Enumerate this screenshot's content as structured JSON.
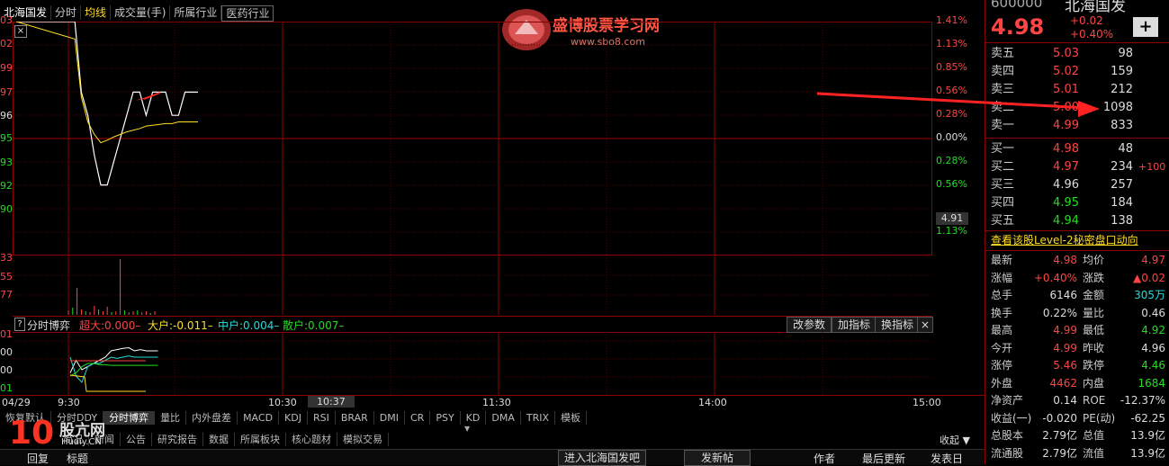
{
  "tabs": [
    "北海国发",
    "分时",
    "均线",
    "成交量(手)",
    "所属行业",
    "医药行业"
  ],
  "watermark": {
    "brand": "盛博股票学习网",
    "url": "www.sbo8.com"
  },
  "price_axis_left": [
    "03",
    "02",
    "99",
    "97",
    "96",
    "95",
    "93",
    "92",
    "90"
  ],
  "pct_axis_right": {
    "up": [
      "1.41%",
      "1.13%",
      "0.85%",
      "0.56%",
      "0.28%"
    ],
    "zero": "0.00%",
    "down": [
      "0.28%",
      "0.56%",
      "0.85%",
      "1.13%"
    ]
  },
  "cursor_price": "4.91",
  "volume_axis_left": [
    "33",
    "55",
    "77"
  ],
  "indicator_bar": {
    "q": "?",
    "name": "分时博弈",
    "super": "超大:0.000–",
    "big": "大户:-0.011–",
    "mid": "中户:0.004–",
    "small": "散户:0.007–",
    "buttons": [
      "改参数",
      "加指标",
      "换指标"
    ],
    "close": "×"
  },
  "indicator_axis_left": [
    "01",
    "00",
    "00",
    "01"
  ],
  "time_axis": {
    "date": "04/29",
    "labels": [
      "9:30",
      "10:30",
      "10:37",
      "11:30",
      "14:00",
      "15:00"
    ]
  },
  "bottom_tabs": [
    "恢复默认",
    "分时DDY",
    "分时博弈",
    "量比",
    "内外盘差",
    "MACD",
    "KDJ",
    "RSI",
    "BRAR",
    "DMI",
    "CR",
    "PSY",
    "KD",
    "DMA",
    "TRIX",
    "模板"
  ],
  "bottom_tabs2": [
    "简况",
    "新闻",
    "公告",
    "研究报告",
    "数据",
    "所属板块",
    "核心题材",
    "模拟交易"
  ],
  "collapse": "收起",
  "footer": {
    "left": [
      "回复",
      "标题"
    ],
    "buttons": [
      "进入北海国发吧",
      "发新帖"
    ],
    "cols": [
      "作者",
      "最后更新",
      "发表日"
    ]
  },
  "logo": {
    "num": "10",
    "text": "股亢网",
    "sub": "Huaiy.CN"
  },
  "quote": {
    "code": "600000",
    "name": "北海国发",
    "price": "4.98",
    "chg": "+0.02",
    "pct": "+0.40%",
    "plus": "+"
  },
  "asks": [
    {
      "label": "卖五",
      "price": "5.03",
      "vol": "98"
    },
    {
      "label": "卖四",
      "price": "5.02",
      "vol": "159"
    },
    {
      "label": "卖三",
      "price": "5.01",
      "vol": "212"
    },
    {
      "label": "卖二",
      "price": "5.00",
      "vol": "1098"
    },
    {
      "label": "卖一",
      "price": "4.99",
      "vol": "833"
    }
  ],
  "bids": [
    {
      "label": "买一",
      "price": "4.98",
      "vol": "48",
      "extra": ""
    },
    {
      "label": "买二",
      "price": "4.97",
      "vol": "234",
      "extra": "+100"
    },
    {
      "label": "买三",
      "price": "4.96",
      "vol": "257",
      "extra": ""
    },
    {
      "label": "买四",
      "price": "4.95",
      "vol": "184",
      "extra": ""
    },
    {
      "label": "买五",
      "price": "4.94",
      "vol": "138",
      "extra": ""
    }
  ],
  "level2": "查看该股Level-2秘密盘口动向",
  "stats": [
    [
      "最新",
      "4.98",
      "均价",
      "4.97"
    ],
    [
      "涨幅",
      "+0.40%",
      "涨跌",
      "▲0.02"
    ],
    [
      "总手",
      "6146",
      "金额",
      "305万"
    ],
    [
      "换手",
      "0.22%",
      "量比",
      "0.46"
    ],
    [
      "最高",
      "4.99",
      "最低",
      "4.92"
    ],
    [
      "今开",
      "4.99",
      "昨收",
      "4.96"
    ],
    [
      "涨停",
      "5.46",
      "跌停",
      "4.46"
    ],
    [
      "外盘",
      "4462",
      "内盘",
      "1684"
    ],
    [
      "净资产",
      "0.14",
      "ROE",
      "-12.37%"
    ],
    [
      "收益(一)",
      "-0.020",
      "PE(动)",
      "-62.25"
    ],
    [
      "总股本",
      "2.79亿",
      "总值",
      "13.9亿"
    ],
    [
      "流通股",
      "2.79亿",
      "流值",
      "13.9亿"
    ]
  ],
  "stat_colors": [
    [
      "#ff4444",
      "#ff4444"
    ],
    [
      "#ff4444",
      "#ff4444"
    ],
    [
      "#dddddd",
      "#22dddd"
    ],
    [
      "#dddddd",
      "#dddddd"
    ],
    [
      "#ff4444",
      "#22dd22"
    ],
    [
      "#ff4444",
      "#dddddd"
    ],
    [
      "#ff4444",
      "#22dd22"
    ],
    [
      "#ff4444",
      "#22dd22"
    ],
    [
      "#dddddd",
      "#dddddd"
    ],
    [
      "#dddddd",
      "#dddddd"
    ],
    [
      "#dddddd",
      "#dddddd"
    ],
    [
      "#dddddd",
      "#dddddd"
    ]
  ],
  "series": {
    "price_pct": [
      1.41,
      1.41,
      0.56,
      0.28,
      -0.2,
      -0.56,
      -0.56,
      -0.28,
      0.0,
      0.28,
      0.56,
      0.56,
      0.28,
      0.56,
      0.56,
      0.56,
      0.28,
      0.28,
      0.56,
      0.56,
      0.56
    ],
    "avg_pct": [
      1.41,
      1.2,
      0.5,
      0.2,
      0.05,
      -0.05,
      -0.02,
      0.02,
      0.05,
      0.08,
      0.1,
      0.12,
      0.15,
      0.16,
      0.17,
      0.18,
      0.18,
      0.2,
      0.2,
      0.2,
      0.2
    ],
    "volume": [
      5,
      8,
      30,
      6,
      4,
      3,
      10,
      6,
      4,
      9,
      3,
      4,
      62,
      5,
      3,
      4,
      5,
      3,
      4,
      2,
      4
    ],
    "big": [
      0.35,
      0.55,
      0.4,
      0.45,
      0.5,
      0.55,
      0.6,
      0.7,
      0.72,
      0.74,
      0.75,
      0.7,
      0.72,
      0.7,
      0.7,
      0.7
    ],
    "mid": [
      0.6,
      0.3,
      0.2,
      0.45,
      0.5,
      0.5,
      0.55,
      0.6,
      0.58,
      0.6,
      0.62,
      0.6,
      0.6,
      0.6,
      0.6,
      0.6
    ],
    "small": [
      0.3,
      0.35,
      0.45,
      0.5,
      0.5,
      0.48,
      0.48,
      0.47,
      0.47,
      0.47,
      0.47,
      0.47,
      0.47,
      0.47,
      0.47,
      0.47
    ]
  }
}
